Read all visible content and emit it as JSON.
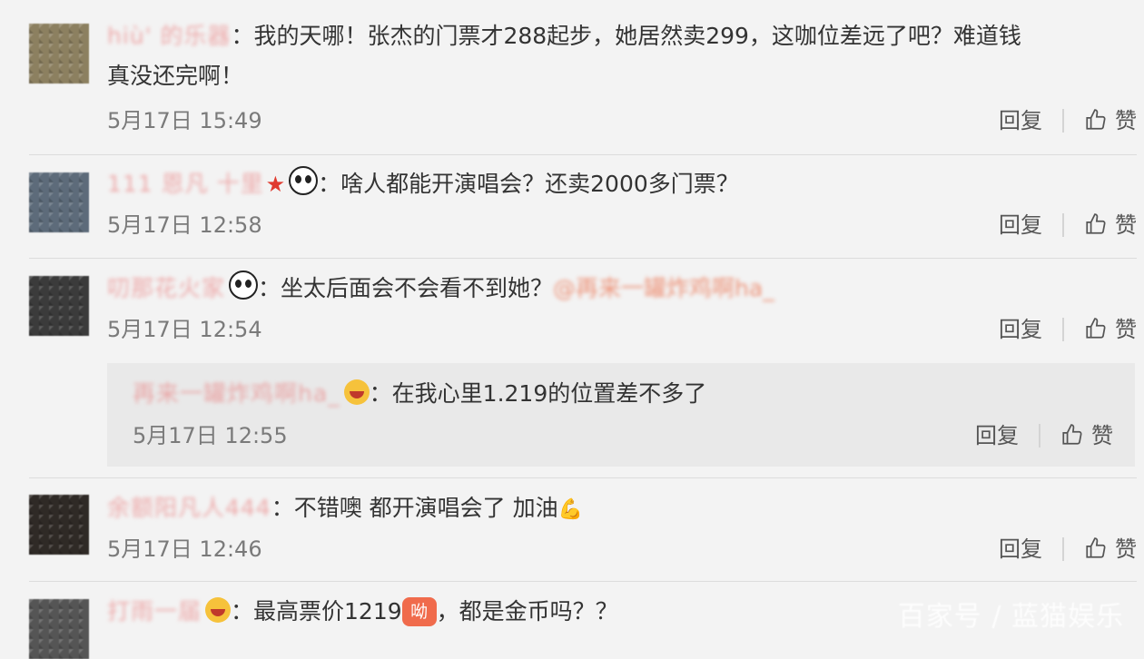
{
  "labels": {
    "reply": "回复",
    "like": "赞"
  },
  "comments": [
    {
      "user": "hiù' 的乐器",
      "text": "：我的天哪！张杰的门票才288起步，她居然卖299，这咖位差远了吧？难道钱真没还完啊！",
      "time": "5月17日 15:49"
    },
    {
      "user": "111 恩凡 十里",
      "text": "：啥人都能开演唱会？还卖2000多门票？",
      "time": "5月17日 12:58"
    },
    {
      "user": "叨那花火家",
      "text": "：坐太后面会不会看不到她？",
      "mention": "@再来一罐炸鸡啊ha_",
      "time": "5月17日 12:54"
    },
    {
      "user": "再来一罐炸鸡啊ha_",
      "text": "：在我心里1.219的位置差不多了",
      "time": "5月17日 12:55"
    },
    {
      "user": "余额阳凡人444",
      "text": "：不错噢 都开演唱会了 加油",
      "time": "5月17日 12:46"
    },
    {
      "user": "打雨一届",
      "text": "：最高票价1219",
      "badge": "呦",
      "text2": "，都是金币吗？？",
      "time": ""
    }
  ],
  "watermark": "百家号 / 蓝猫娱乐",
  "colors": {
    "username": "#e96b6b",
    "mention": "#eb7350",
    "background": "#f3f3f3",
    "reply_bg": "#e9e9e9"
  }
}
